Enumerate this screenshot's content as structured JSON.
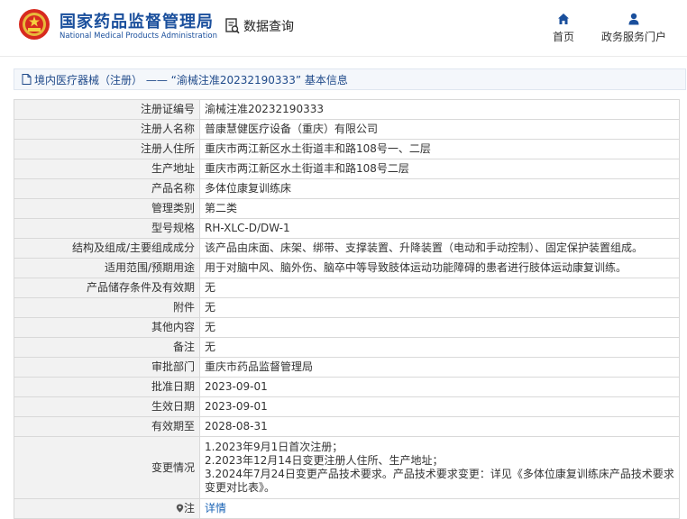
{
  "header": {
    "logo_cn": "国家药品监督管理局",
    "logo_en": "National Medical Products Administration",
    "query_label": "数据查询",
    "nav": [
      {
        "label": "首页",
        "icon": "home-icon"
      },
      {
        "label": "政务服务门户",
        "icon": "user-icon"
      }
    ]
  },
  "breadcrumb": {
    "text": "境内医疗器械（注册） —— “渝械注准20232190333” 基本信息"
  },
  "fields": {
    "reg_no": {
      "label": "注册证编号",
      "value": "渝械注准20232190333"
    },
    "registrant": {
      "label": "注册人名称",
      "value": "普康慧健医疗设备（重庆）有限公司"
    },
    "reg_address": {
      "label": "注册人住所",
      "value": "重庆市两江新区水土街道丰和路108号一、二层"
    },
    "prod_address": {
      "label": "生产地址",
      "value": "重庆市两江新区水土街道丰和路108号二层"
    },
    "product_name": {
      "label": "产品名称",
      "value": "多体位康复训练床"
    },
    "category": {
      "label": "管理类别",
      "value": "第二类"
    },
    "model": {
      "label": "型号规格",
      "value": "RH-XLC-D/DW-1"
    },
    "structure": {
      "label": "结构及组成/主要组成成分",
      "value": "该产品由床面、床架、绑带、支撑装置、升降装置（电动和手动控制）、固定保护装置组成。"
    },
    "scope": {
      "label": "适用范围/预期用途",
      "value": "用于对脑中风、脑外伤、脑卒中等导致肢体运动功能障碍的患者进行肢体运动康复训练。"
    },
    "storage": {
      "label": "产品储存条件及有效期",
      "value": "无"
    },
    "attachment": {
      "label": "附件",
      "value": "无"
    },
    "other": {
      "label": "其他内容",
      "value": "无"
    },
    "remark": {
      "label": "备注",
      "value": "无"
    },
    "dept": {
      "label": "审批部门",
      "value": "重庆市药品监督管理局"
    },
    "approve_date": {
      "label": "批准日期",
      "value": "2023-09-01"
    },
    "effect_date": {
      "label": "生效日期",
      "value": "2023-09-01"
    },
    "expiry": {
      "label": "有效期至",
      "value": "2028-08-31"
    },
    "changes": {
      "label": "变更情况",
      "lines": [
        "1.2023年9月1日首次注册；",
        "2.2023年12月14日变更注册人住所、生产地址；",
        "3.2024年7月24日变更产品技术要求。产品技术要求变更：详见《多体位康复训练床产品技术要求变更对比表》。"
      ]
    },
    "note": {
      "label": "注",
      "value": "详情"
    }
  }
}
